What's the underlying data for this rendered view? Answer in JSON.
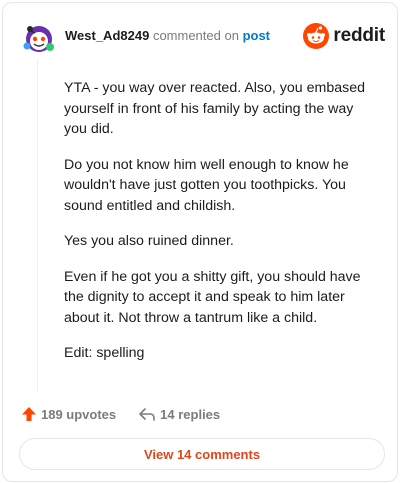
{
  "header": {
    "username": "West_Ad8249",
    "commented_on_text": "commented on",
    "post_link": "post",
    "logo_text": "reddit",
    "brand_color": "#ff4500"
  },
  "comment": {
    "paragraphs": [
      "YTA - you way over reacted. Also, you embased yourself in front of his family by acting the way you did.",
      "Do you not know him well enough to know he wouldn't have just gotten you toothpicks. You sound entitled and childish.",
      "Yes you also ruined dinner.",
      "Even if he got you a shitty gift, you should have the dignity to accept it and speak to him later about it. Not throw a tantrum like a child.",
      "Edit: spelling"
    ]
  },
  "actions": {
    "upvotes": "189 upvotes",
    "replies": "14 replies",
    "upvote_icon": "upvote-arrow-icon",
    "reply_icon": "reply-arrow-icon"
  },
  "footer": {
    "view_comments": "View 14 comments"
  }
}
